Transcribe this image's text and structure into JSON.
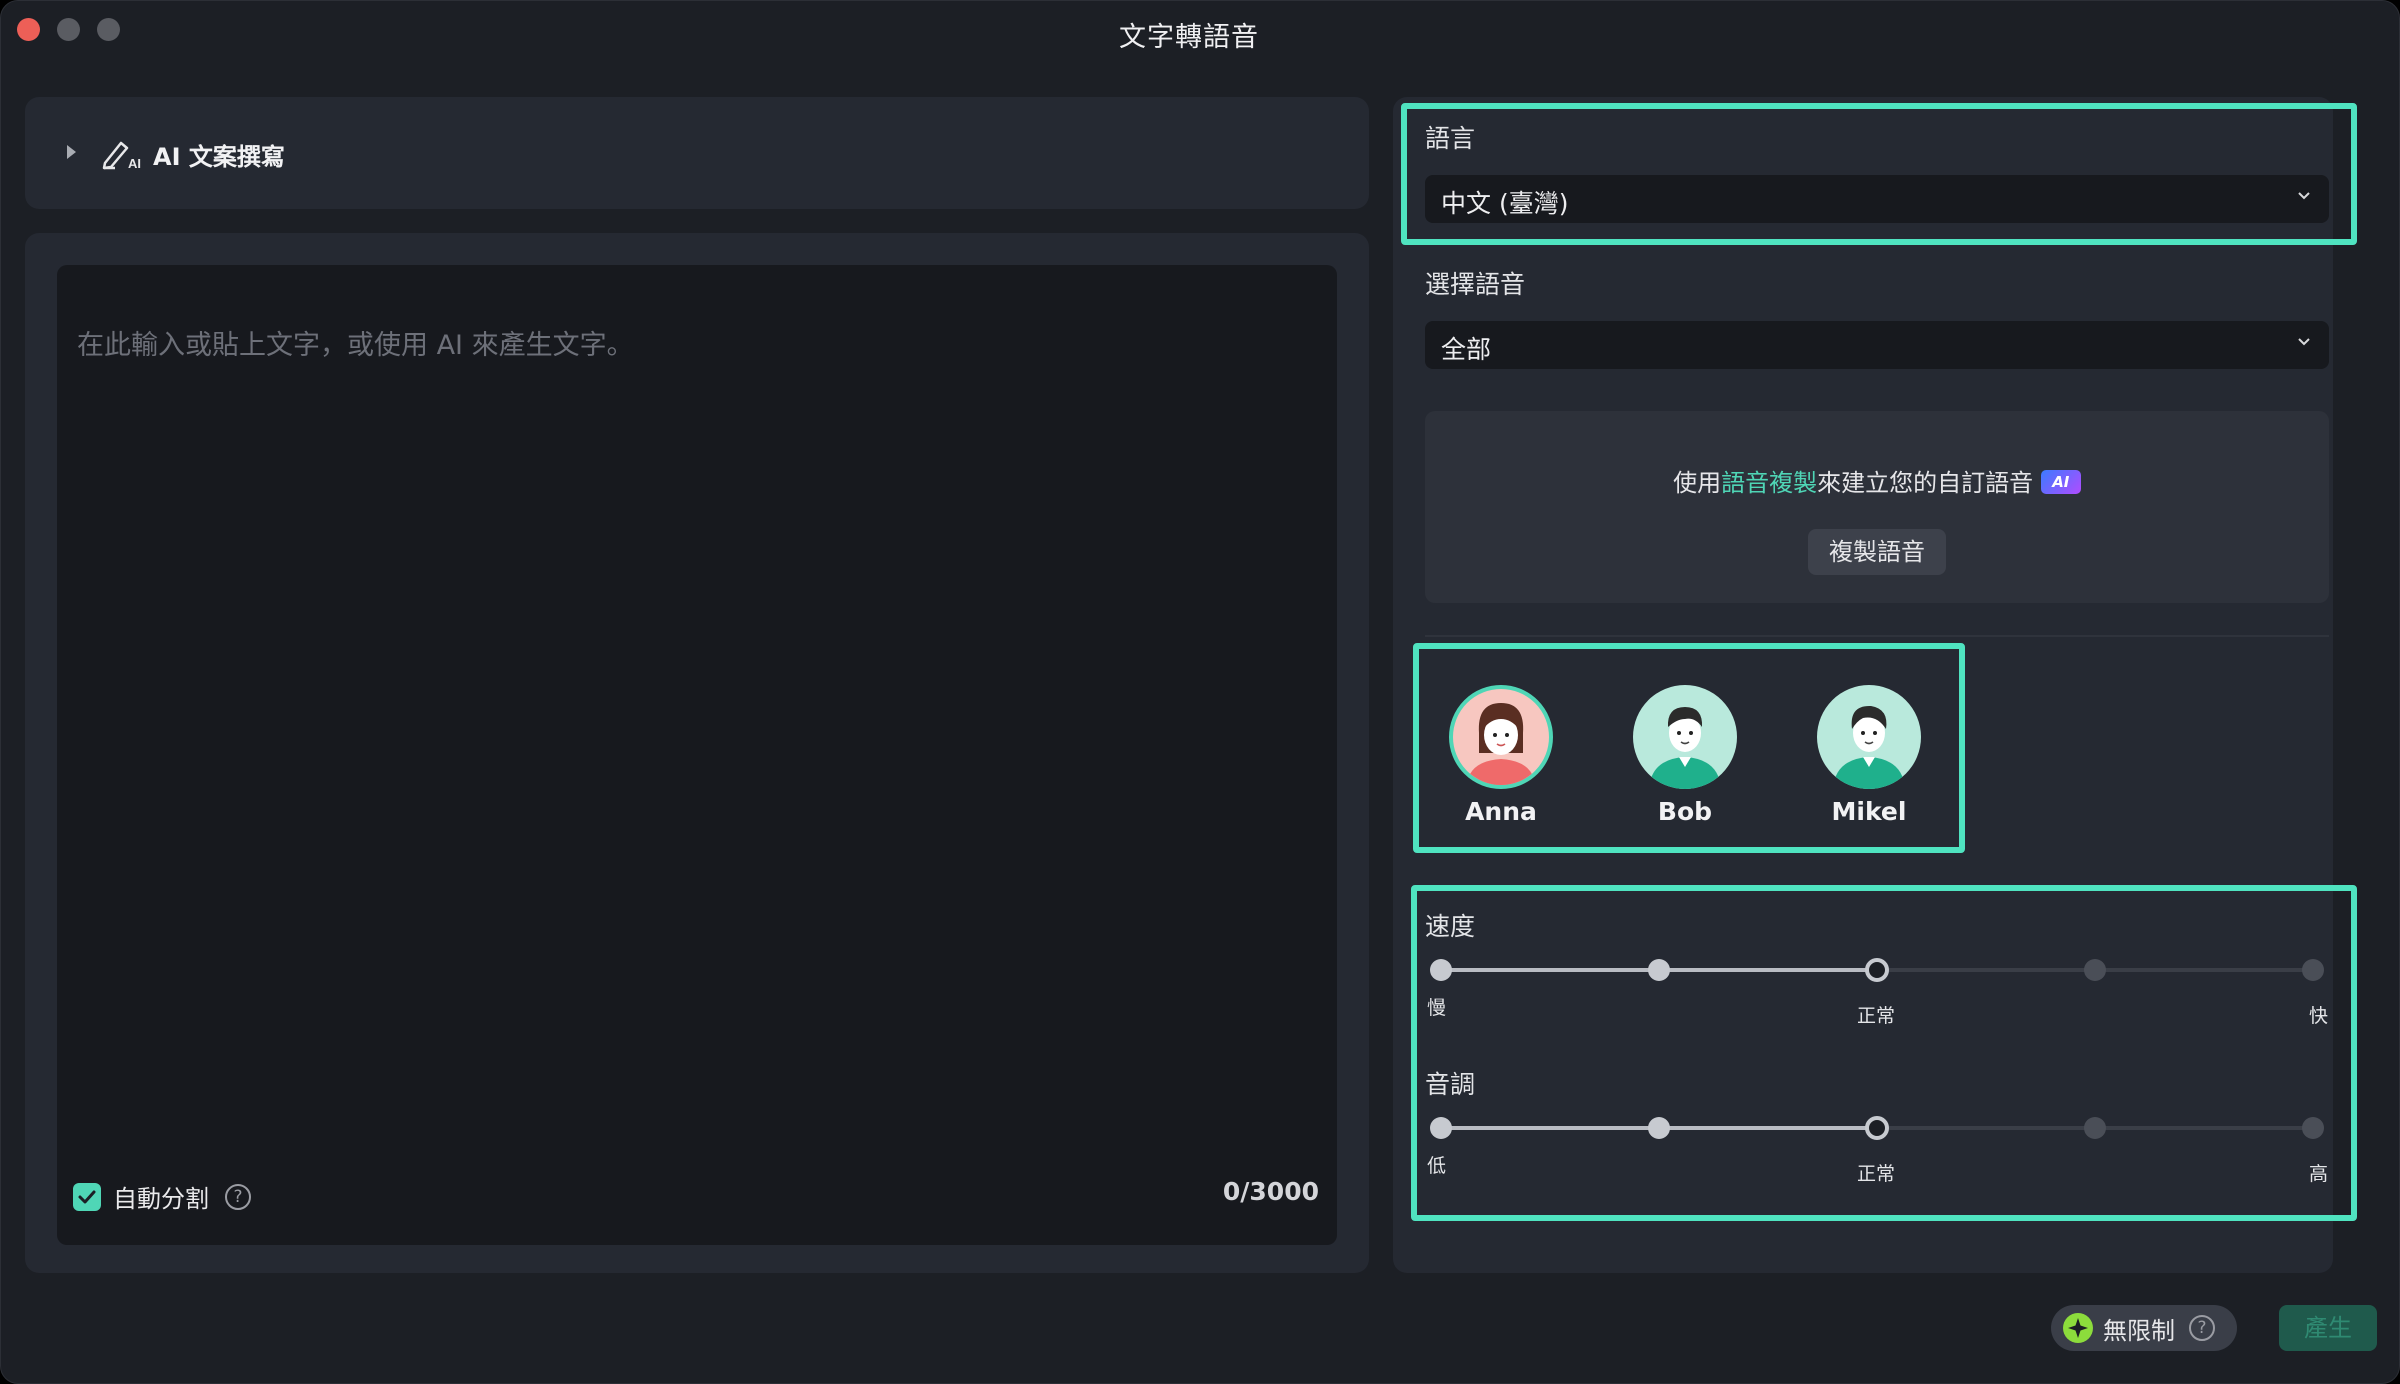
{
  "window": {
    "title": "文字轉語音"
  },
  "ai_writer": {
    "label": "AI 文案撰寫"
  },
  "editor": {
    "placeholder": "在此輸入或貼上文字，或使用 AI 來產生文字。",
    "auto_split_label": "自動分割",
    "auto_split_checked": true,
    "char_count": "0/3000"
  },
  "language": {
    "label": "語言",
    "value": "中文 (臺灣)"
  },
  "voice_select": {
    "label": "選擇語音",
    "value": "全部"
  },
  "clone": {
    "text_before": "使用",
    "link": "語音複製",
    "text_after": "來建立您的自訂語音",
    "badge": "AI",
    "button": "複製語音"
  },
  "voices": [
    {
      "name": "Anna",
      "selected": true
    },
    {
      "name": "Bob",
      "selected": false
    },
    {
      "name": "Mikel",
      "selected": false
    }
  ],
  "speed": {
    "label": "速度",
    "min_label": "慢",
    "mid_label": "正常",
    "max_label": "快",
    "level": 3,
    "steps": 5
  },
  "pitch": {
    "label": "音調",
    "min_label": "低",
    "mid_label": "正常",
    "max_label": "高",
    "level": 3,
    "steps": 5
  },
  "footer": {
    "unlimited_label": "無限制",
    "generate_label": "產生"
  },
  "colors": {
    "accent": "#4fd6b6",
    "highlight": "#4fe3c0",
    "background": "#1c1f25",
    "panel": "#252932"
  }
}
